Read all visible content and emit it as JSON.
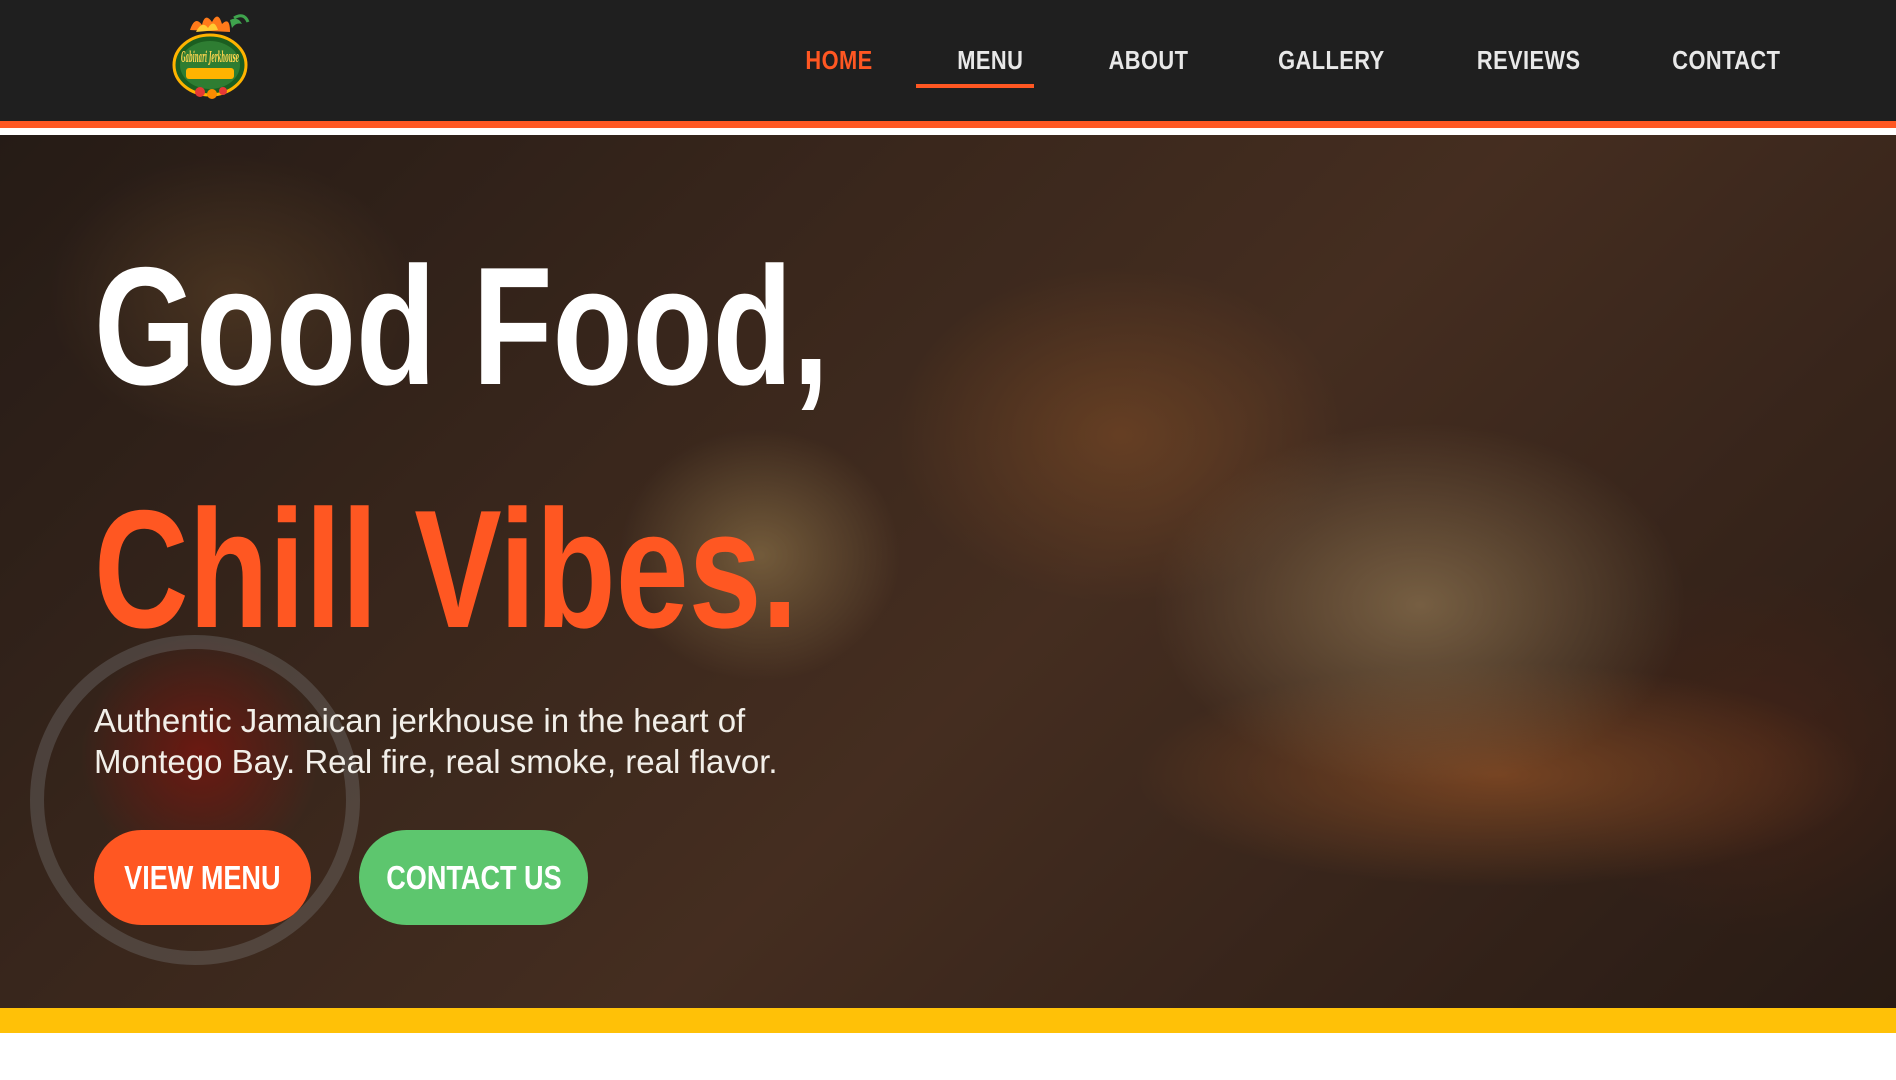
{
  "header": {
    "logo": {
      "icon": "gabinari-jerkhouse-logo",
      "brand_text": "Gabinari Jerkhouse"
    },
    "nav": [
      {
        "label": "HOME",
        "active": true
      },
      {
        "label": "MENU",
        "active": false
      },
      {
        "label": "ABOUT",
        "active": false
      },
      {
        "label": "GALLERY",
        "active": false
      },
      {
        "label": "REVIEWS",
        "active": false
      },
      {
        "label": "CONTACT",
        "active": false
      }
    ]
  },
  "hero": {
    "title_line1": "Good Food,",
    "title_line2": "Chill Vibes.",
    "subtitle": "Authentic Jamaican jerkhouse in the heart of Montego Bay. Real fire, real smoke, real flavor.",
    "buttons": {
      "view_menu": "VIEW MENU",
      "contact_us": "CONTACT US"
    }
  },
  "colors": {
    "header_bg": "#1f1f1f",
    "accent_orange": "#ff5722",
    "accent_green": "#5dc66e",
    "band_yellow": "#ffc107"
  }
}
